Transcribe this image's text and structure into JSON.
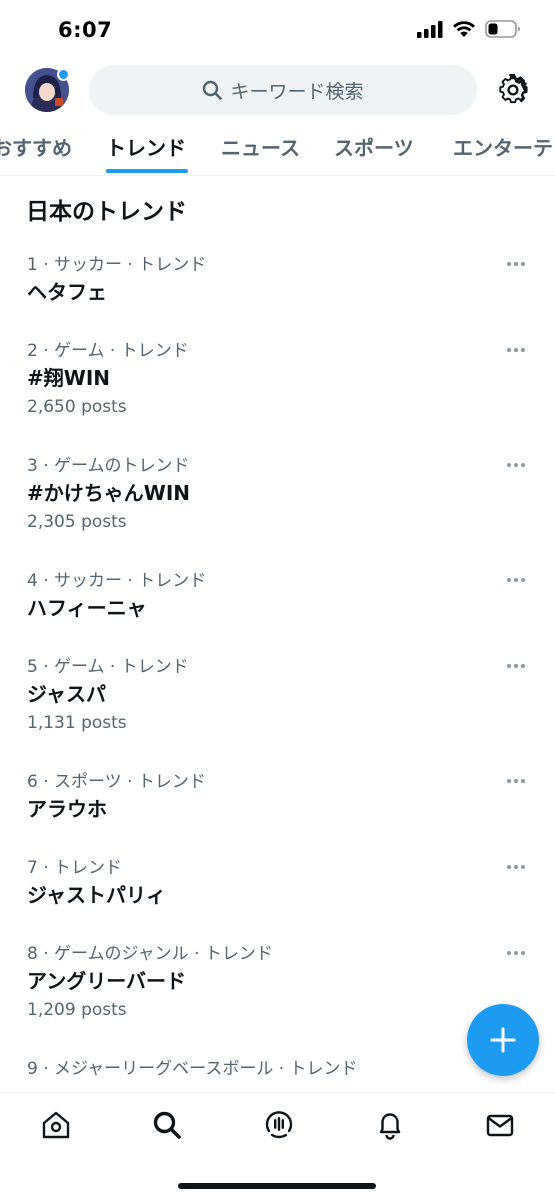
{
  "status_bar": {
    "time": "6:07",
    "icons": [
      "cellular-signal-icon",
      "wifi-icon",
      "battery-icon"
    ]
  },
  "header": {
    "avatar": "user-avatar",
    "search_placeholder": "キーワード検索",
    "settings_icon": "gear-icon"
  },
  "tabs": [
    {
      "label": "おすすめ",
      "active": false
    },
    {
      "label": "トレンド",
      "active": true
    },
    {
      "label": "ニュース",
      "active": false
    },
    {
      "label": "スポーツ",
      "active": false
    },
    {
      "label": "エンターテ",
      "active": false
    }
  ],
  "section_title": "日本のトレンド",
  "trends": [
    {
      "meta": "1 · サッカー · トレンド",
      "name": "ヘタフェ",
      "posts": ""
    },
    {
      "meta": "2 · ゲーム · トレンド",
      "name": "#翔WIN",
      "posts": "2,650 posts"
    },
    {
      "meta": "3 · ゲームのトレンド",
      "name": "#かけちゃんWIN",
      "posts": "2,305 posts"
    },
    {
      "meta": "4 · サッカー · トレンド",
      "name": "ハフィーニャ",
      "posts": ""
    },
    {
      "meta": "5 · ゲーム · トレンド",
      "name": "ジャスパ",
      "posts": "1,131 posts"
    },
    {
      "meta": "6 · スポーツ · トレンド",
      "name": "アラウホ",
      "posts": ""
    },
    {
      "meta": "7 · トレンド",
      "name": "ジャストパリィ",
      "posts": ""
    },
    {
      "meta": "8 · ゲームのジャンル · トレンド",
      "name": "アングリーバード",
      "posts": "1,209 posts"
    },
    {
      "meta": "9 · メジャーリーグベースボール · トレンド",
      "name": "",
      "posts": ""
    }
  ],
  "fab": {
    "icon": "plus-icon"
  },
  "bottom_nav": [
    {
      "icon": "home-icon"
    },
    {
      "icon": "search-icon",
      "active": true
    },
    {
      "icon": "spaces-icon"
    },
    {
      "icon": "bell-icon"
    },
    {
      "icon": "mail-icon"
    }
  ],
  "colors": {
    "accent": "#1d9bf0",
    "text_primary": "#0f1419",
    "text_secondary": "#536471",
    "search_bg": "#eff3f4"
  }
}
